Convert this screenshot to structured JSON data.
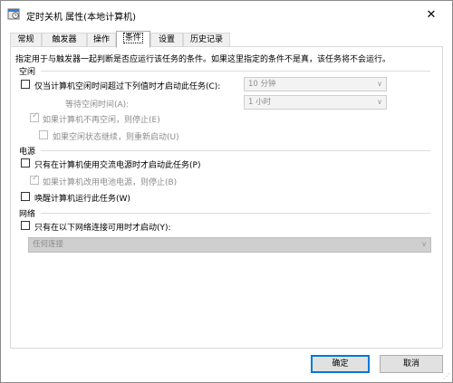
{
  "window": {
    "title": "定时关机 属性(本地计算机)",
    "close_glyph": "✕"
  },
  "tabs": [
    {
      "label": "常规"
    },
    {
      "label": "触发器"
    },
    {
      "label": "操作"
    },
    {
      "label": "条件",
      "active": true
    },
    {
      "label": "设置"
    },
    {
      "label": "历史记录"
    }
  ],
  "description": "指定用于与触发器一起判断是否应运行该任务的条件。如果这里指定的条件不是真，该任务将不会运行。",
  "idle": {
    "group_label": "空闲",
    "start_if_idle_label": "仅当计算机空闲时间超过下列值时才启动此任务(C):",
    "start_if_idle_checked": false,
    "idle_duration_value": "10 分钟",
    "wait_idle_label": "等待空闲时间(A):",
    "wait_idle_value": "1 小时",
    "stop_if_not_idle_label": "如果计算机不再空闲，则停止(E)",
    "stop_if_not_idle_checked": true,
    "restart_if_idle_label": "如果空闲状态继续，则重新启动(U)",
    "restart_if_idle_checked": false
  },
  "power": {
    "group_label": "电源",
    "ac_only_label": "只有在计算机使用交流电源时才启动此任务(P)",
    "ac_only_checked": false,
    "stop_on_battery_label": "如果计算机改用电池电源，则停止(B)",
    "stop_on_battery_checked": true,
    "wake_label": "唤醒计算机运行此任务(W)",
    "wake_checked": false
  },
  "network": {
    "group_label": "网络",
    "start_if_network_label": "只有在以下网络连接可用时才启动(Y):",
    "start_if_network_checked": false,
    "network_value": "任何连接"
  },
  "buttons": {
    "ok_label": "确定",
    "cancel_label": "取消"
  }
}
